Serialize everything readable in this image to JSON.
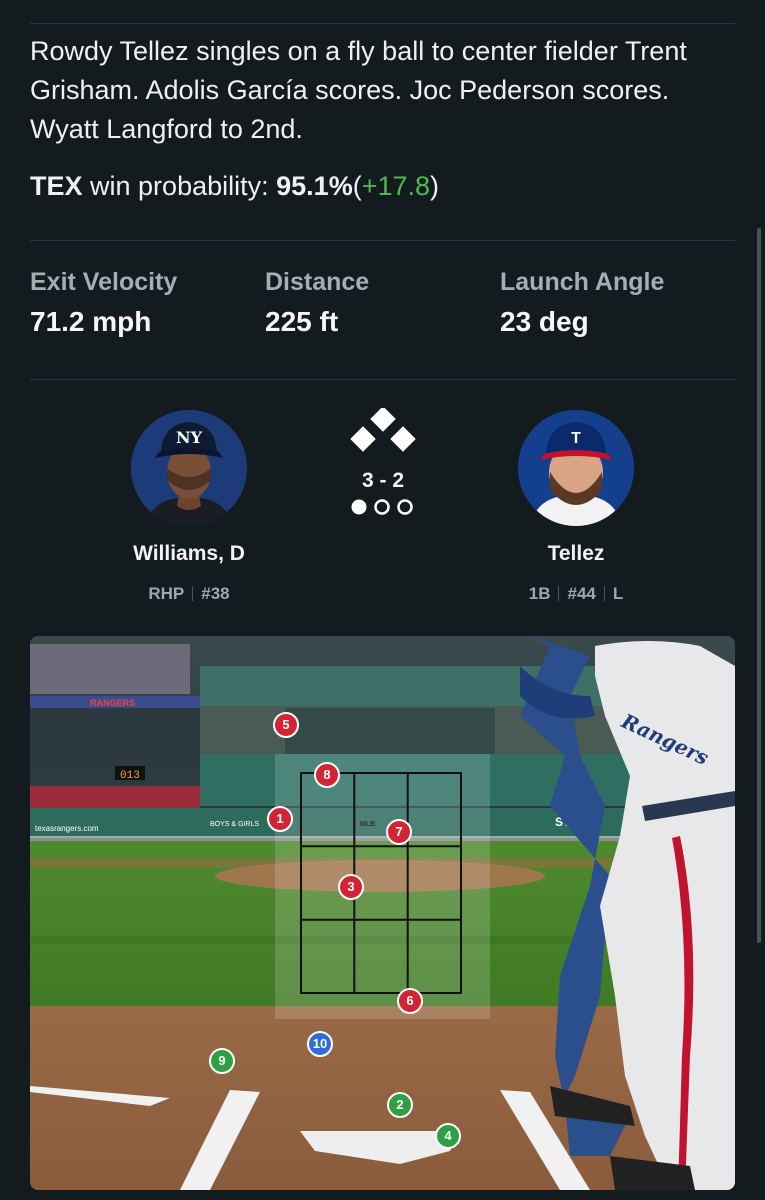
{
  "play": {
    "description": "Rowdy Tellez singles on a fly ball to center fielder Trent Grisham. Adolis García scores. Joc Pederson scores. Wyatt Langford to 2nd."
  },
  "win_probability": {
    "team": "TEX",
    "label": "win probability:",
    "value": "95.1%",
    "open_paren": "(",
    "change": "+17.8",
    "close_paren": ")"
  },
  "stats": [
    {
      "label": "Exit Velocity",
      "value": "71.2 mph"
    },
    {
      "label": "Distance",
      "value": "225 ft"
    },
    {
      "label": "Launch Angle",
      "value": "23 deg"
    }
  ],
  "matchup": {
    "pitcher": {
      "name": "Williams, D",
      "position": "RHP",
      "number": "#38",
      "cap_logo": "NY",
      "team_color": "#0c2340"
    },
    "batter": {
      "name": "Tellez",
      "position": "1B",
      "number": "#44",
      "bats": "L",
      "cap_logo": "T",
      "team_color": "#003278"
    },
    "count": "3 - 2",
    "outs": 1,
    "max_outs": 3,
    "bases": {
      "first": true,
      "second": true,
      "third": true
    }
  },
  "field": {
    "wall_text": "RANGERS",
    "scoreboard_text": "013",
    "ad_text": "texasrangers.com",
    "sponsor_text": "BOYS & GIRLS",
    "sponsor2_text": "ST2C",
    "uniform_text": "Rangers",
    "logo_text": "MLB"
  },
  "pitches": [
    {
      "n": "1",
      "result": "ball"
    },
    {
      "n": "2",
      "result": "strike"
    },
    {
      "n": "3",
      "result": "ball"
    },
    {
      "n": "4",
      "result": "strike"
    },
    {
      "n": "5",
      "result": "ball"
    },
    {
      "n": "6",
      "result": "ball"
    },
    {
      "n": "7",
      "result": "ball"
    },
    {
      "n": "8",
      "result": "ball"
    },
    {
      "n": "9",
      "result": "strike"
    },
    {
      "n": "10",
      "result": "in-play"
    }
  ],
  "colors": {
    "background": "#141b1f",
    "positive": "#4fb84f",
    "ball": "#d32436",
    "strike": "#2ea043",
    "in_play": "#2d6fd6"
  }
}
